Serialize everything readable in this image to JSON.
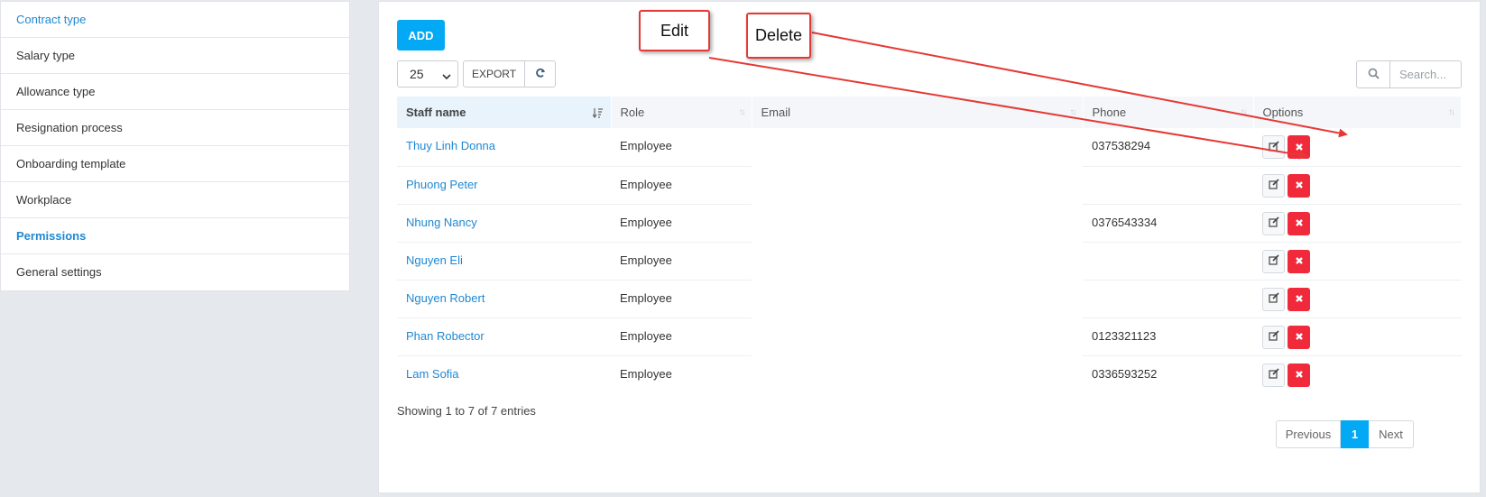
{
  "sidebar": {
    "items": [
      {
        "label": "Contract type",
        "state": "link"
      },
      {
        "label": "Salary type",
        "state": "normal"
      },
      {
        "label": "Allowance type",
        "state": "normal"
      },
      {
        "label": "Resignation process",
        "state": "normal"
      },
      {
        "label": "Onboarding template",
        "state": "normal"
      },
      {
        "label": "Workplace",
        "state": "normal"
      },
      {
        "label": "Permissions",
        "state": "active"
      },
      {
        "label": "General settings",
        "state": "normal"
      }
    ]
  },
  "toolbar": {
    "add_label": "ADD",
    "page_length": "25",
    "export_label": "EXPORT",
    "refresh_icon": "refresh-icon",
    "search_placeholder": "Search..."
  },
  "table": {
    "columns": [
      "Staff name",
      "Role",
      "Email",
      "Phone",
      "Options"
    ],
    "rows": [
      {
        "name": "Thuy Linh Donna",
        "role": "Employee",
        "email": "",
        "phone": "037538294"
      },
      {
        "name": "Phuong Peter",
        "role": "Employee",
        "email": "",
        "phone": ""
      },
      {
        "name": "Nhung Nancy",
        "role": "Employee",
        "email": "",
        "phone": "0376543334"
      },
      {
        "name": "Nguyen Eli",
        "role": "Employee",
        "email": "",
        "phone": ""
      },
      {
        "name": "Nguyen Robert",
        "role": "Employee",
        "email": "",
        "phone": ""
      },
      {
        "name": "Phan Robector",
        "role": "Employee",
        "email": "",
        "phone": "0123321123"
      },
      {
        "name": "Lam Sofia",
        "role": "Employee",
        "email": "",
        "phone": "0336593252"
      }
    ]
  },
  "footer": {
    "info": "Showing 1 to 7 of 7 entries",
    "prev_label": "Previous",
    "page": "1",
    "next_label": "Next"
  },
  "annotations": {
    "edit_label": "Edit",
    "delete_label": "Delete"
  },
  "colors": {
    "accent": "#03a9f4",
    "link": "#1e88d3",
    "danger": "#f0293b",
    "callout_border": "#e53935"
  }
}
